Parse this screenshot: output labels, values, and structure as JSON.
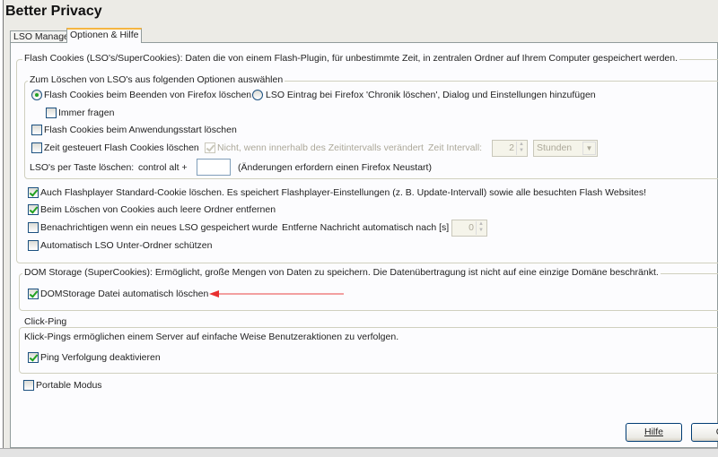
{
  "window": {
    "title": "Better Privacy"
  },
  "tabs": [
    {
      "label": "LSO Manager",
      "active": false
    },
    {
      "label": "Optionen & Hilfe",
      "active": true
    }
  ],
  "flash": {
    "legend": "Flash Cookies (LSO's/SuperCookies): Daten die von einem Flash-Plugin, für unbestimmte Zeit, in zentralen Ordner auf Ihrem Computer gespeichert werden.",
    "sub_legend": "Zum Löschen von LSO's aus folgenden Optionen auswählen",
    "radio_exit": "Flash Cookies beim Beenden von Firefox löschen",
    "radio_history": "LSO Eintrag bei Firefox 'Chronik löschen', Dialog und Einstellungen hinzufügen",
    "always_ask": "Immer fragen",
    "on_start": "Flash Cookies beim Anwendungsstart löschen",
    "timed": "Zeit gesteuert Flash Cookies löschen",
    "not_if_changed": "Nicht, wenn innerhalb des Zeitintervalls verändert",
    "interval_label": "Zeit Intervall:",
    "interval_value": "2",
    "interval_unit": "Stunden",
    "hotkey_label": "LSO's per Taste löschen:",
    "hotkey_prefix": "control alt +",
    "hotkey_value": "",
    "hotkey_note": "(Änderungen erfordern einen Firefox Neustart)",
    "default_cookie": "Auch Flashplayer Standard-Cookie löschen. Es speichert Flashplayer-Einstellungen (z. B. Update-Intervall) sowie alle besuchten Flash Websites!",
    "empty_folders": "Beim Löschen von Cookies auch leere Ordner entfernen",
    "notify": "Benachrichtigen wenn ein neues LSO gespeichert wurde",
    "remove_msg_label": "Entferne Nachricht automatisch nach [s]",
    "remove_msg_value": "0",
    "protect_sub": "Automatisch LSO Unter-Ordner schützen"
  },
  "dom": {
    "legend": "DOM Storage (SuperCookies): Ermöglicht, große Mengen von Daten zu speichern. Die Datenübertragung ist nicht auf eine einzige Domäne beschränkt.",
    "auto_delete": "DOMStorage Datei automatisch löschen",
    "arrow_color": "#e83030"
  },
  "ping": {
    "legend": "Click-Ping",
    "desc": "Klick-Pings ermöglichen einem Server auf einfache Weise Benutzeraktionen zu verfolgen.",
    "disable": "Ping Verfolgung deaktivieren"
  },
  "portable": "Portable Modus",
  "buttons": {
    "help": "Hilfe",
    "close": "C"
  }
}
